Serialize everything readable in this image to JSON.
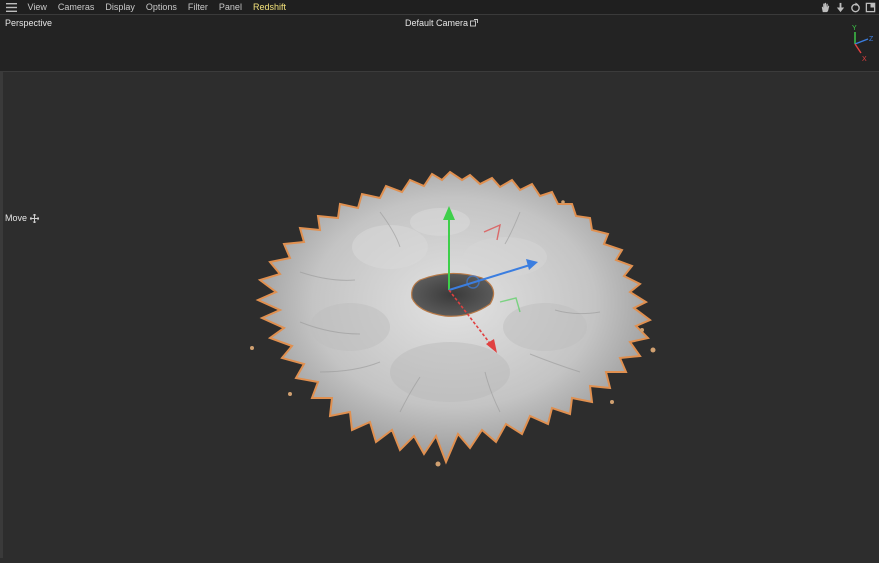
{
  "menubar": {
    "items": [
      {
        "label": "View"
      },
      {
        "label": "Cameras"
      },
      {
        "label": "Display"
      },
      {
        "label": "Options"
      },
      {
        "label": "Filter"
      },
      {
        "label": "Panel"
      },
      {
        "label": "Redshift"
      }
    ],
    "active_color": "#f3e27a",
    "nav_icons": [
      "hand-pan-icon",
      "dolly-arrow-icon",
      "rotate-icon",
      "maximize-icon"
    ]
  },
  "viewport": {
    "view_name": "Perspective",
    "camera": "Default Camera",
    "active_tool": "Move",
    "axes": {
      "y": "Y",
      "z": "Z",
      "x": "X"
    },
    "axis_colors": {
      "x": "#e04040",
      "y": "#3ecf4a",
      "z": "#3b7ee0"
    }
  },
  "scene": {
    "object": "splash-ring-mesh",
    "mesh_color": "#c8c8c8",
    "selection_outline_color": "#e09050"
  }
}
